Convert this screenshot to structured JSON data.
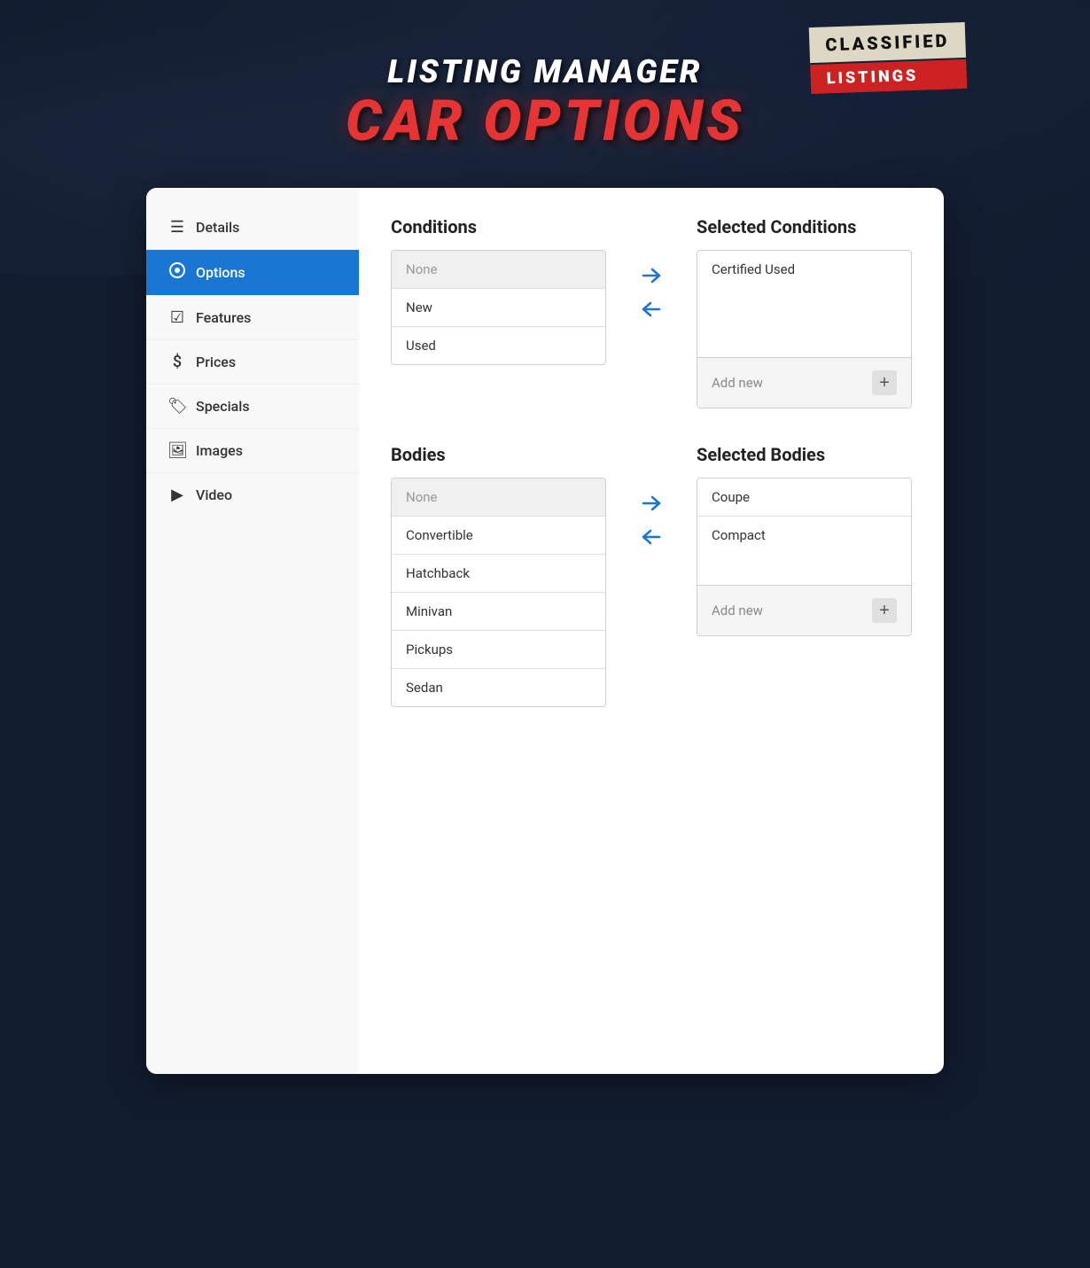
{
  "header": {
    "subtitle": "LISTING MANAGER",
    "title": "CAR OPTIONS"
  },
  "sidebar": {
    "items": [
      {
        "id": "details",
        "label": "Details",
        "icon": "≡"
      },
      {
        "id": "options",
        "label": "Options",
        "icon": "⚙",
        "active": true
      },
      {
        "id": "features",
        "label": "Features",
        "icon": "☑"
      },
      {
        "id": "prices",
        "label": "Prices",
        "icon": "$"
      },
      {
        "id": "specials",
        "label": "Specials",
        "icon": "🏷"
      },
      {
        "id": "images",
        "label": "Images",
        "icon": "🖼"
      },
      {
        "id": "video",
        "label": "Video",
        "icon": "▶"
      }
    ]
  },
  "conditions": {
    "section_title": "Conditions",
    "selected_title": "Selected Conditions",
    "available_items": [
      {
        "id": "none",
        "label": "None",
        "type": "none"
      },
      {
        "id": "new",
        "label": "New",
        "type": "item"
      },
      {
        "id": "used",
        "label": "Used",
        "type": "item"
      }
    ],
    "selected_items": [
      {
        "id": "certified-used",
        "label": "Certified Used"
      }
    ],
    "add_new_label": "Add new",
    "arrow_right": "→",
    "arrow_left": "←"
  },
  "bodies": {
    "section_title": "Bodies",
    "selected_title": "Selected Bodies",
    "available_items": [
      {
        "id": "none",
        "label": "None",
        "type": "none"
      },
      {
        "id": "convertible",
        "label": "Convertible",
        "type": "item"
      },
      {
        "id": "hatchback",
        "label": "Hatchback",
        "type": "item"
      },
      {
        "id": "minivan",
        "label": "Minivan",
        "type": "item"
      },
      {
        "id": "pickups",
        "label": "Pickups",
        "type": "item"
      },
      {
        "id": "sedan",
        "label": "Sedan",
        "type": "item"
      }
    ],
    "selected_items": [
      {
        "id": "coupe",
        "label": "Coupe"
      },
      {
        "id": "compact",
        "label": "Compact"
      }
    ],
    "add_new_label": "Add new",
    "arrow_right": "→",
    "arrow_left": "←"
  },
  "colors": {
    "active_sidebar": "#1976d2",
    "arrow_color": "#1976d2",
    "title_red": "#e63333"
  }
}
